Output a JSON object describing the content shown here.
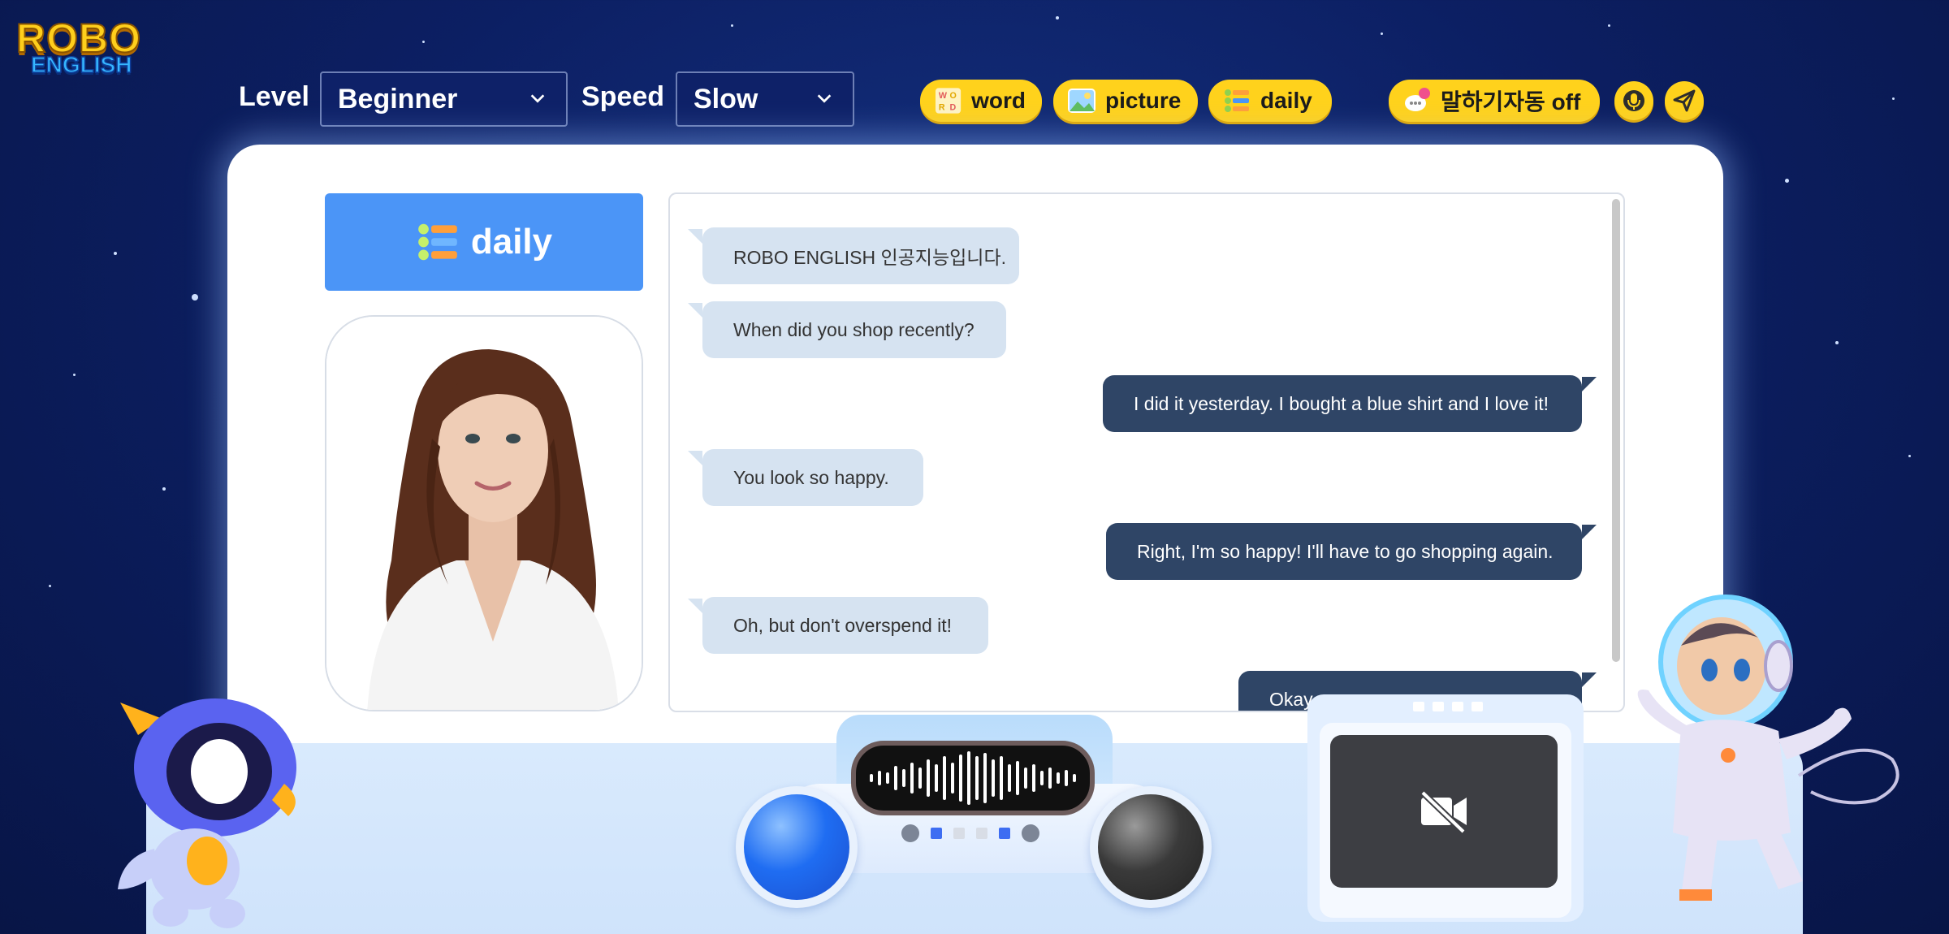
{
  "logo": {
    "line1": "ROBO",
    "line2": "ENGLISH"
  },
  "toolbar": {
    "level_label": "Level",
    "level_value": "Beginner",
    "speed_label": "Speed",
    "speed_value": "Slow",
    "word_label": "word",
    "picture_label": "picture",
    "daily_label": "daily",
    "auto_speak_label": "말하기자동 off"
  },
  "mode": {
    "label": "daily"
  },
  "chat": {
    "messages": [
      {
        "role": "bot",
        "text": "ROBO ENGLISH 인공지능입니다."
      },
      {
        "role": "bot",
        "text": "When did you shop recently?"
      },
      {
        "role": "user",
        "text": "I did it yesterday. I bought a blue shirt and I love it!"
      },
      {
        "role": "bot",
        "text": "You look so happy."
      },
      {
        "role": "user",
        "text": "Right, I'm so happy! I'll have to go shopping again."
      },
      {
        "role": "bot",
        "text": "Oh, but don't overspend it!"
      },
      {
        "role": "user",
        "text": "Okay"
      }
    ]
  },
  "colors": {
    "accent_yellow": "#ffd21c",
    "mode_blue": "#4b95f7",
    "user_bubble": "#2f4566",
    "bot_bubble": "#d6e3f1"
  },
  "icons": [
    "chevron-down-icon",
    "word-icon",
    "picture-icon",
    "daily-list-icon",
    "chat-bubble-icon",
    "microphone-icon",
    "send-icon",
    "camera-off-icon",
    "voice-wave-icon"
  ]
}
